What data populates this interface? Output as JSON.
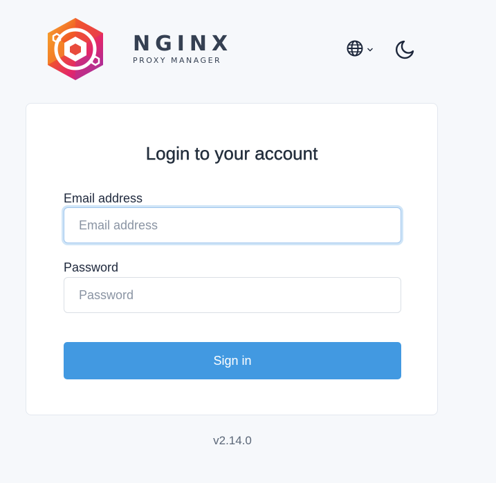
{
  "header": {
    "brand_title": "NGINX",
    "brand_subtitle": "PROXY MANAGER",
    "language_icon": "globe-icon",
    "theme_icon": "moon-icon"
  },
  "login": {
    "title": "Login to your account",
    "email_label": "Email address",
    "email_placeholder": "Email address",
    "email_value": "",
    "password_label": "Password",
    "password_placeholder": "Password",
    "password_value": "",
    "submit_label": "Sign in"
  },
  "footer": {
    "version": "v2.14.0"
  },
  "colors": {
    "background": "#f6f8fb",
    "primary": "#4299e1",
    "text": "#1d273b"
  }
}
